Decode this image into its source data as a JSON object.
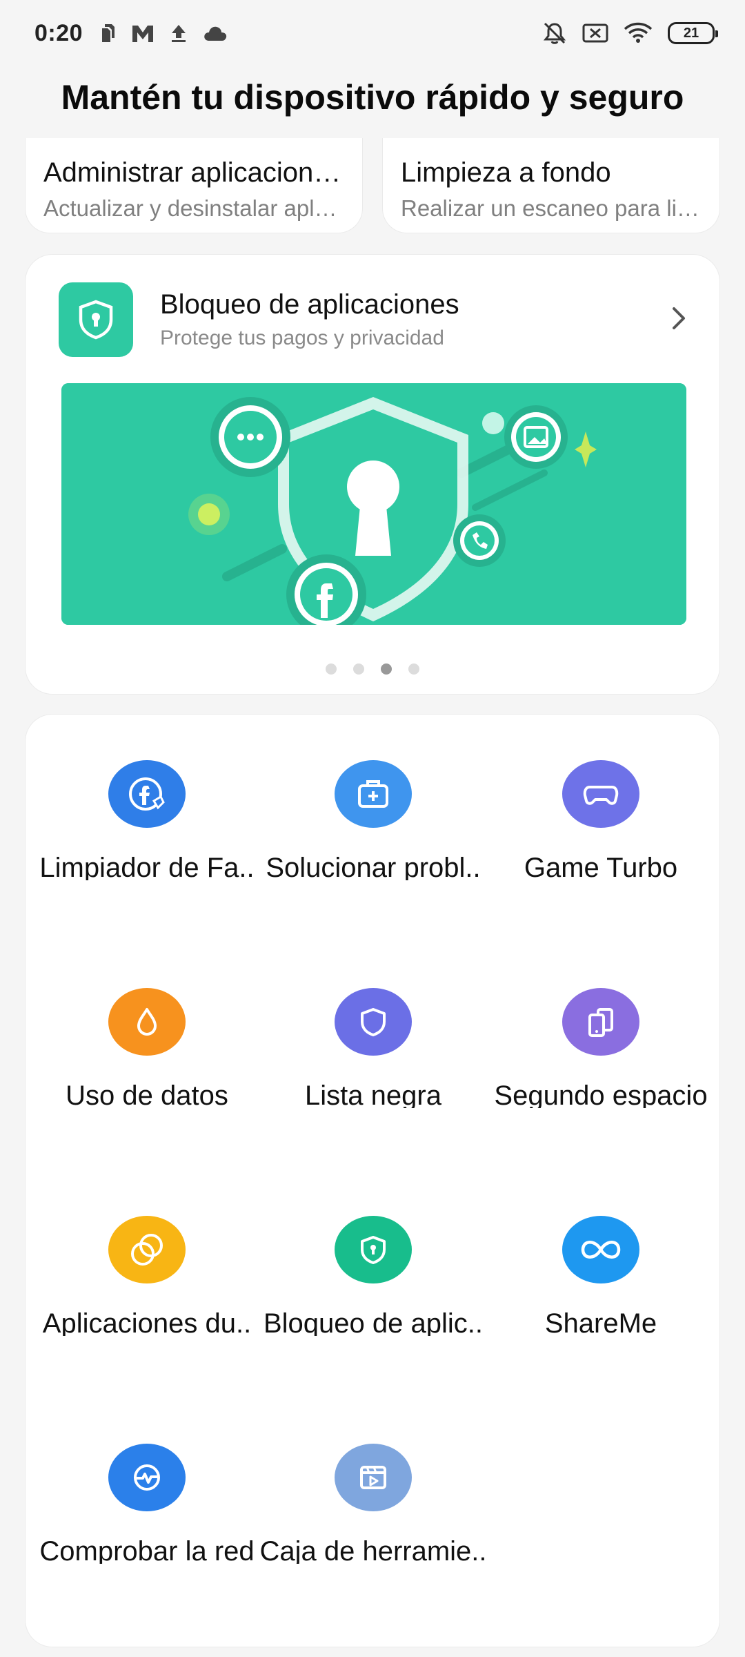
{
  "status_bar": {
    "time": "0:20",
    "battery": "21",
    "left_icons": [
      "sim-icon",
      "m-logo-icon",
      "upload-icon",
      "cloud-icon"
    ],
    "right_icons": [
      "bell-muted-icon",
      "sim-off-icon",
      "wifi-icon",
      "battery-icon"
    ]
  },
  "page": {
    "title": "Mantén tu dispositivo rápido y seguro"
  },
  "top_cards": [
    {
      "title": "Administrar aplicacion…",
      "subtitle": "Actualizar y desinstalar apl…"
    },
    {
      "title": "Limpieza a fondo",
      "subtitle": "Realizar un escaneo para li…"
    }
  ],
  "banner_card": {
    "title": "Bloqueo de aplicaciones",
    "subtitle": "Protege tus pagos y privacidad",
    "icon": "shield-lock-icon",
    "page_count": 4,
    "active_page": 3,
    "accent": "#2ec9a2"
  },
  "tools": [
    {
      "label": "Limpiador de Fa..",
      "icon": "facebook-clean-icon",
      "color": "#2f7ee8"
    },
    {
      "label": "Solucionar probl..",
      "icon": "medkit-icon",
      "color": "#3f95ee"
    },
    {
      "label": "Game Turbo",
      "icon": "gamepad-icon",
      "color": "#6e72e8"
    },
    {
      "label": "Uso de datos",
      "icon": "droplet-icon",
      "color": "#f7921e"
    },
    {
      "label": "Lista negra",
      "icon": "shield-icon",
      "color": "#6b6fe6"
    },
    {
      "label": "Segundo espacio",
      "icon": "dual-phone-icon",
      "color": "#8a6ee0"
    },
    {
      "label": "Aplicaciones du..",
      "icon": "dual-circles-icon",
      "color": "#f8b514"
    },
    {
      "label": "Bloqueo de aplic..",
      "icon": "shield-lock-icon",
      "color": "#18bd8c"
    },
    {
      "label": "ShareMe",
      "icon": "infinity-icon",
      "color": "#1e98f0"
    },
    {
      "label": "Comprobar la red",
      "icon": "network-check-icon",
      "color": "#2b80ea"
    },
    {
      "label": "Caja de herramie..",
      "icon": "toolbox-icon",
      "color": "#7fa6de"
    }
  ]
}
